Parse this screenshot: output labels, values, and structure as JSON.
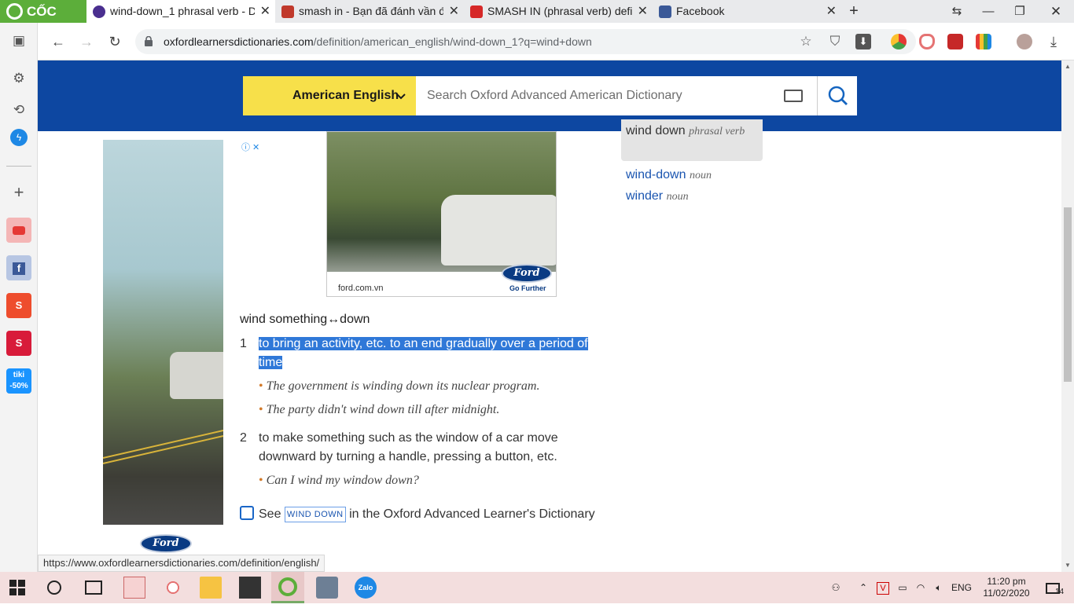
{
  "browser": {
    "brand": "CỐC CỐC",
    "tabs": [
      {
        "title": "wind-down_1 phrasal verb - D",
        "active": true,
        "icon": "oxford-favicon"
      },
      {
        "title": "smash in - Bạn đã đánh vần đ",
        "active": false,
        "icon": "cambridge-favicon"
      },
      {
        "title": "SMASH IN (phrasal verb) defi",
        "active": false,
        "icon": "red-logo-favicon"
      },
      {
        "title": "Facebook",
        "active": false,
        "icon": "facebook-favicon"
      }
    ],
    "new_tab": "+",
    "url_domain": "oxfordlearnersdictionaries.com",
    "url_path": "/definition/american_english/wind-down_1?q=wind+down"
  },
  "header": {
    "dictionary": "American English",
    "search_placeholder": "Search Oxford Advanced American Dictionary"
  },
  "ads": {
    "left_brand": "Ford",
    "top_domain": "ford.com.vn",
    "top_tagline": "Go Further",
    "top_brand": "Ford"
  },
  "entry": {
    "headword": "wind something↔down",
    "senses": [
      {
        "num": "1",
        "definition": "to bring an activity, etc. to an end gradually over a period of time"
      },
      {
        "num": "2",
        "definition": "to make something such as the window of a car move downward by turning a handle, pressing a button, etc."
      }
    ],
    "examples": [
      "The government is winding down its nuclear program.",
      "The party didn't wind down till after midnight.",
      "Can I wind my window down?"
    ],
    "see_prefix": "See",
    "see_link": "WIND DOWN",
    "see_suffix": "in the Oxford Advanced Learner's Dictionary"
  },
  "related": {
    "current_word": "wind down",
    "current_pos": "phrasal verb",
    "items": [
      {
        "word": "wind-down",
        "pos": "noun"
      },
      {
        "word": "winder",
        "pos": "noun"
      }
    ]
  },
  "status_url": "https://www.oxfordlearnersdictionaries.com/definition/english/",
  "taskbar": {
    "language": "ENG",
    "time": "11:20 pm",
    "date": "11/02/2020",
    "notifications": "14"
  },
  "colors": {
    "header_blue": "#0d47a1",
    "dict_yellow": "#f7e04a",
    "highlight_blue": "#2f78d8",
    "link_blue": "#1a55b0",
    "bullet_orange": "#d27a2a",
    "brand_green": "#5cae3a"
  }
}
